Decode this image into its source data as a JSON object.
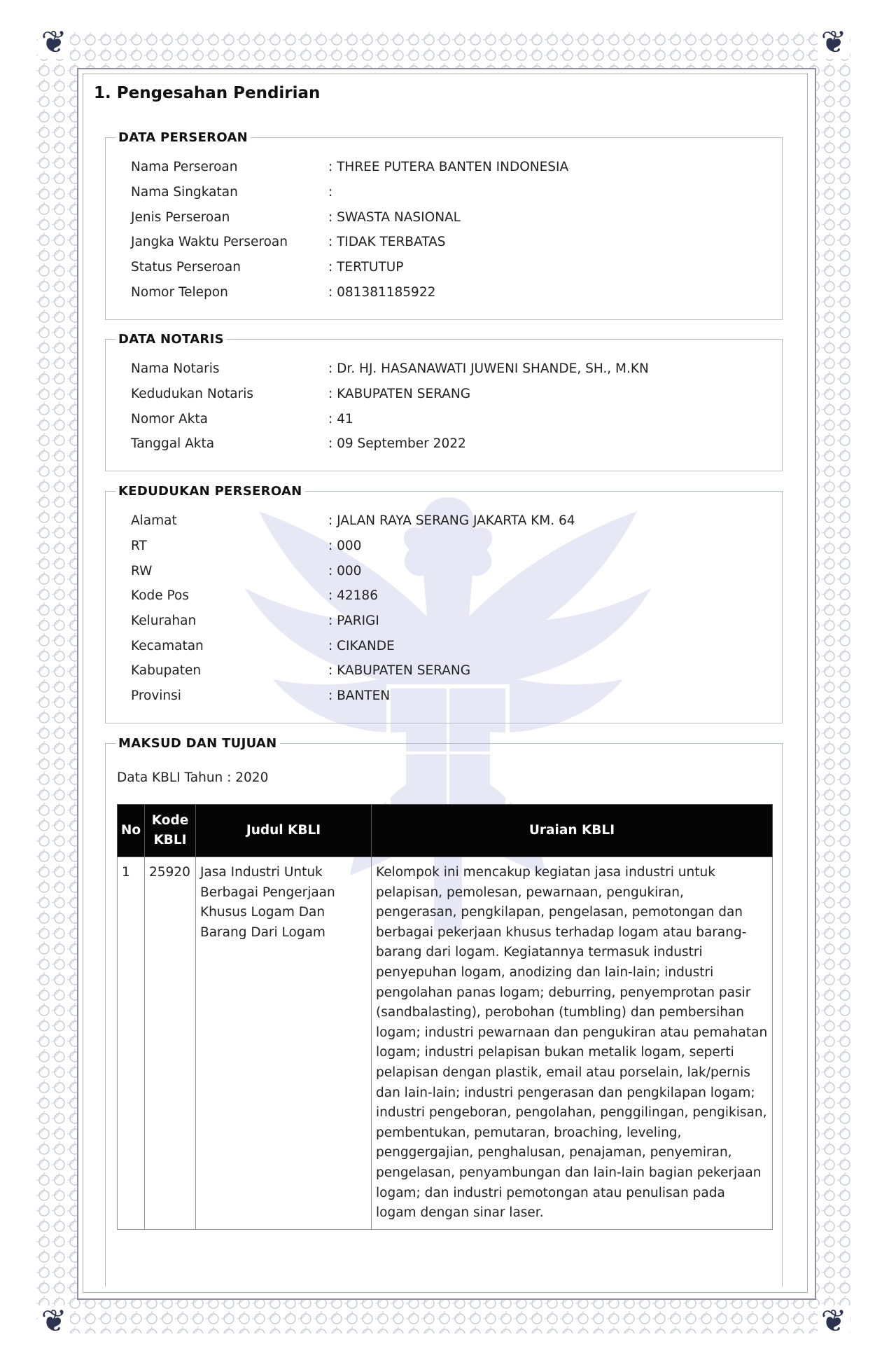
{
  "page_title": "1. Pengesahan Pendirian",
  "data_perseroan": {
    "legend": "DATA PERSEROAN",
    "rows": [
      {
        "label": "Nama Perseroan",
        "value": ": THREE PUTERA BANTEN INDONESIA"
      },
      {
        "label": "Nama Singkatan",
        "value": ":"
      },
      {
        "label": "Jenis Perseroan",
        "value": ": SWASTA NASIONAL"
      },
      {
        "label": "Jangka Waktu Perseroan",
        "value": ": TIDAK TERBATAS"
      },
      {
        "label": "Status Perseroan",
        "value": ": TERTUTUP"
      },
      {
        "label": "Nomor Telepon",
        "value": ": 081381185922"
      }
    ]
  },
  "data_notaris": {
    "legend": "DATA NOTARIS",
    "rows": [
      {
        "label": "Nama Notaris",
        "value": ": Dr. HJ. HASANAWATI JUWENI SHANDE, SH., M.KN"
      },
      {
        "label": "Kedudukan Notaris",
        "value": ": KABUPATEN SERANG"
      },
      {
        "label": "Nomor Akta",
        "value": ": 41"
      },
      {
        "label": "Tanggal Akta",
        "value": ": 09 September 2022"
      }
    ]
  },
  "kedudukan_perseroan": {
    "legend": "KEDUDUKAN PERSEROAN",
    "rows": [
      {
        "label": "Alamat",
        "value": ": JALAN RAYA SERANG JAKARTA KM. 64"
      },
      {
        "label": "RT",
        "value": ": 000"
      },
      {
        "label": "RW",
        "value": ": 000"
      },
      {
        "label": "Kode Pos",
        "value": ": 42186"
      },
      {
        "label": "Kelurahan",
        "value": ": PARIGI"
      },
      {
        "label": "Kecamatan",
        "value": ": CIKANDE"
      },
      {
        "label": "Kabupaten",
        "value": ": KABUPATEN SERANG"
      },
      {
        "label": "Provinsi",
        "value": ": BANTEN"
      }
    ]
  },
  "maksud_tujuan": {
    "legend": "MAKSUD DAN TUJUAN",
    "kbli_year": "Data KBLI Tahun : 2020",
    "headers": {
      "no": "No",
      "kode": "Kode KBLI",
      "judul": "Judul KBLI",
      "uraian": "Uraian KBLI"
    },
    "rows": [
      {
        "no": "1",
        "kode": "25920",
        "judul": "Jasa Industri Untuk Berbagai Pengerjaan Khusus Logam Dan Barang Dari Logam",
        "uraian": "Kelompok ini mencakup kegiatan jasa industri untuk pelapisan, pemolesan, pewarnaan, pengukiran, pengerasan, pengkilapan, pengelasan, pemotongan dan berbagai pekerjaan khusus terhadap logam atau barang-barang dari logam. Kegiatannya termasuk industri penyepuhan logam, anodizing dan lain-lain; industri pengolahan panas logam; deburring, penyemprotan pasir (sandbalasting), perobohan (tumbling) dan pembersihan logam; industri pewarnaan dan pengukiran atau pemahatan logam; industri pelapisan bukan metalik logam, seperti pelapisan dengan plastik, email atau porselain, lak/pernis dan lain-lain; industri pengerasan dan pengkilapan logam; industri pengeboran, pengolahan, penggilingan, pengikisan, pembentukan, pemutaran, broaching, leveling, penggergajian, penghalusan, penajaman, penyemiran, pengelasan, penyambungan dan lain-lain bagian pekerjaan logam; dan industri pemotongan atau penulisan pada logam dengan sinar laser."
      }
    ]
  },
  "decor": {
    "corner_icon": "ornament-icon",
    "watermark_icon": "garuda-emblem-icon",
    "ink_color": "#2b3350"
  }
}
